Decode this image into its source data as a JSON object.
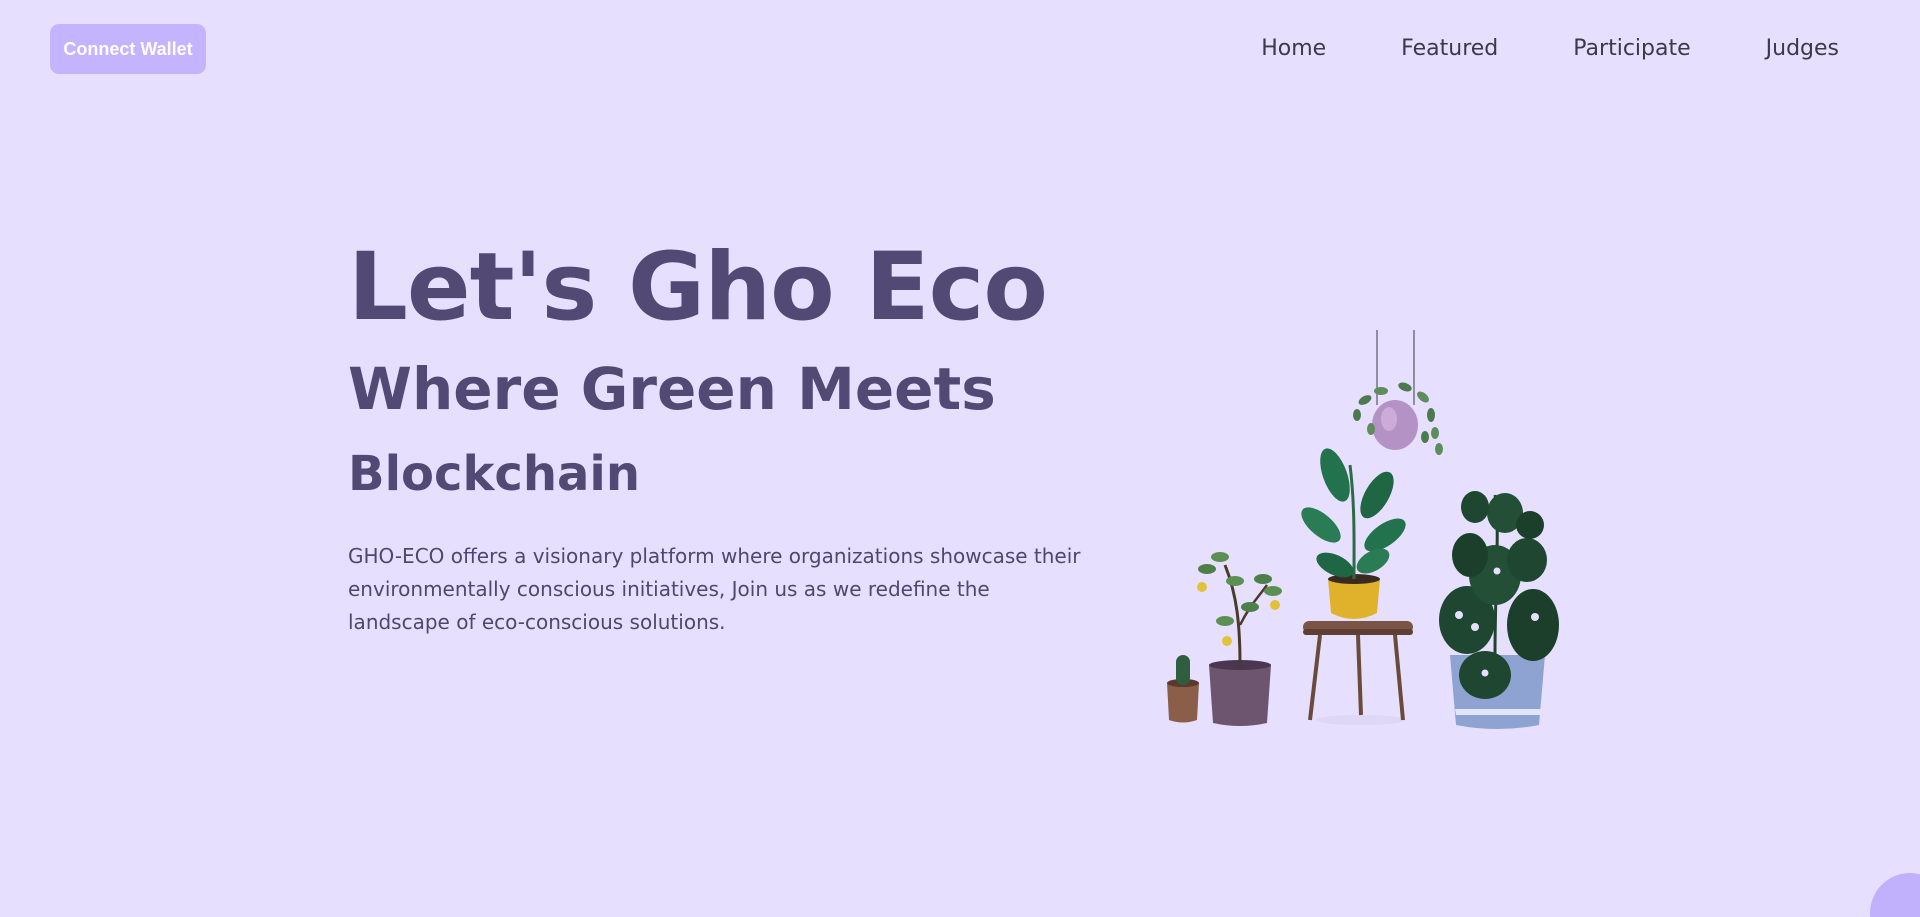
{
  "header": {
    "connect_wallet_label": "Connect Wallet"
  },
  "nav": {
    "items": [
      {
        "label": "Home"
      },
      {
        "label": "Featured"
      },
      {
        "label": "Participate"
      },
      {
        "label": "Judges"
      }
    ]
  },
  "hero": {
    "title": "Let's Gho Eco",
    "subtitle_line1": "Where Green Meets",
    "subtitle_line2": "Blockchain",
    "description": "GHO-ECO offers a visionary platform where organizations showcase their environmentally conscious initiatives, Join us as we redefine the landscape of eco-conscious solutions."
  },
  "illustration": {
    "subject": "potted-plants-illustration"
  },
  "colors": {
    "background": "#e6e0fe",
    "button": "#c4b4fd",
    "heading": "#524a74",
    "text": "#4f4770"
  }
}
